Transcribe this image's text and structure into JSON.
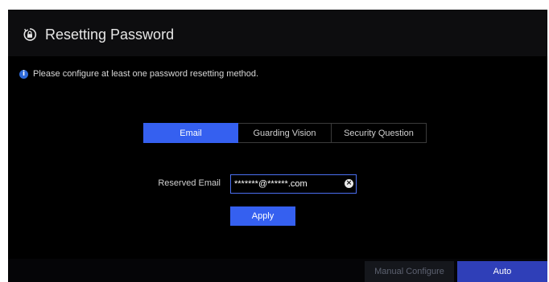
{
  "dialog": {
    "title": "Resetting Password",
    "title_icon": "lock-reset-icon",
    "info_icon": "info-icon",
    "info_text": "Please configure at least one password resetting method."
  },
  "tabs": [
    {
      "label": "Email",
      "active": true
    },
    {
      "label": "Guarding Vision",
      "active": false
    },
    {
      "label": "Security Question",
      "active": false
    }
  ],
  "form": {
    "email_label": "Reserved Email",
    "email_value": "*******@******.com",
    "clear_icon": "clear-circle-icon",
    "apply_label": "Apply"
  },
  "footer": {
    "manual_label": "Manual Configure",
    "auto_label": "Auto"
  },
  "colors": {
    "accent": "#3560f0",
    "auto_button": "#2f3fb8",
    "background": "#000000"
  }
}
